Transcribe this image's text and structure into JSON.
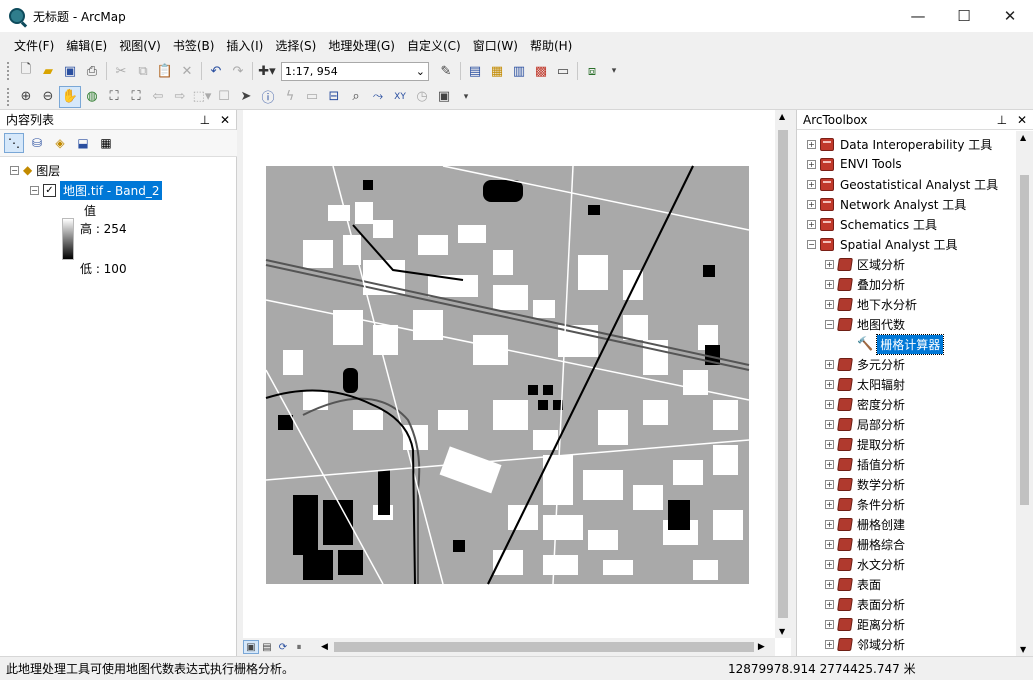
{
  "window": {
    "title": "无标题 - ArcMap",
    "minimize": "—",
    "maximize": "☐",
    "close": "✕"
  },
  "menu": [
    "文件(F)",
    "编辑(E)",
    "视图(V)",
    "书签(B)",
    "插入(I)",
    "选择(S)",
    "地理处理(G)",
    "自定义(C)",
    "窗口(W)",
    "帮助(H)"
  ],
  "toolbar": {
    "scale": "1:17, 954"
  },
  "toc": {
    "title": "内容列表",
    "layers_group": "图层",
    "layer_name": "地图.tif - Band_2",
    "legend_title": "值",
    "legend_high": "高 : 254",
    "legend_low": "低 : 100"
  },
  "toolbox": {
    "title": "ArcToolbox",
    "toolsets": [
      "Data Interoperability 工具",
      "ENVI Tools",
      "Geostatistical Analyst 工具",
      "Network Analyst 工具",
      "Schematics 工具",
      "Spatial Analyst 工具"
    ],
    "spatial_children": [
      "区域分析",
      "叠加分析",
      "地下水分析",
      "地图代数"
    ],
    "selected_tool": "栅格计算器",
    "spatial_children_after": [
      "多元分析",
      "太阳辐射",
      "密度分析",
      "局部分析",
      "提取分析",
      "插值分析",
      "数学分析",
      "条件分析",
      "栅格创建",
      "栅格综合",
      "水文分析",
      "表面",
      "表面分析",
      "距离分析",
      "邻域分析"
    ]
  },
  "status": {
    "message": "此地理处理工具可使用地图代数表达式执行栅格分析。",
    "coords": "12879978.914  2774425.747 米"
  },
  "colors": {
    "selection": "#0078d7",
    "map_gray": "#a9a9a9"
  }
}
